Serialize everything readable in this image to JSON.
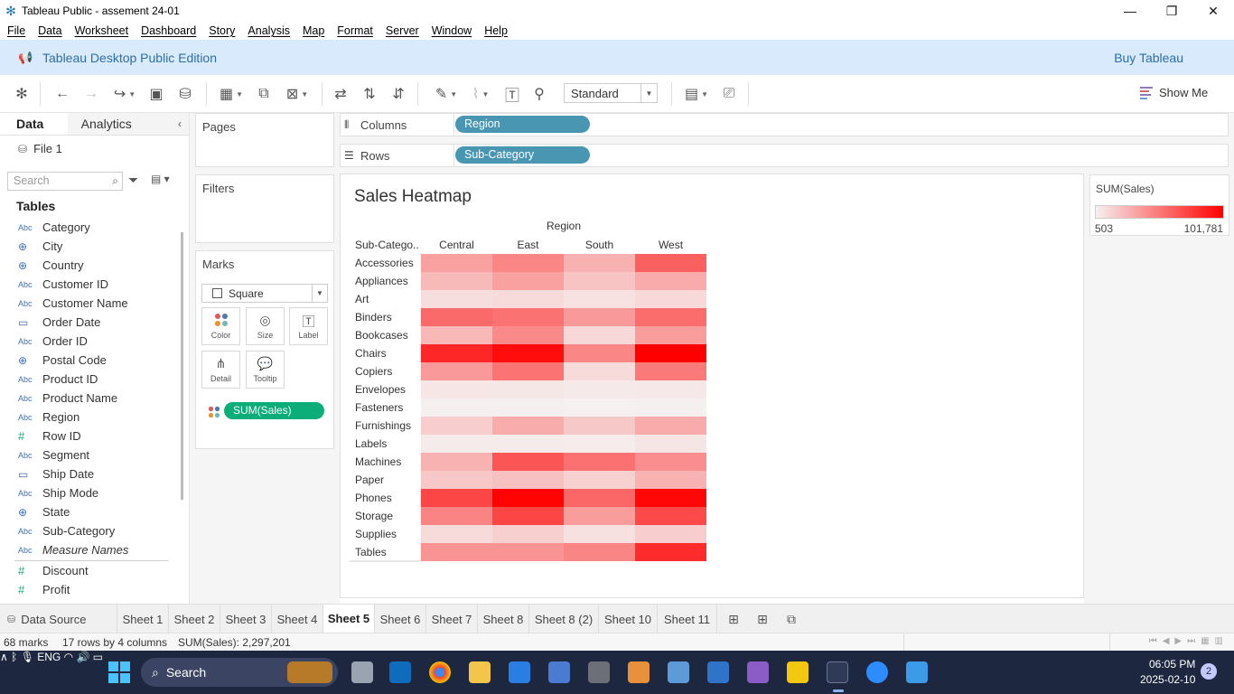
{
  "window": {
    "title": "Tableau Public - assement 24-01"
  },
  "menu": [
    "File",
    "Data",
    "Worksheet",
    "Dashboard",
    "Story",
    "Analysis",
    "Map",
    "Format",
    "Server",
    "Window",
    "Help"
  ],
  "banner": {
    "edition": "Tableau Desktop Public Edition",
    "buy": "Buy Tableau"
  },
  "toolbar": {
    "fit": "Standard",
    "show_me": "Show Me"
  },
  "data_pane": {
    "tabs": [
      "Data",
      "Analytics"
    ],
    "datasource": "File 1",
    "search_placeholder": "Search",
    "tables_label": "Tables",
    "dimensions": [
      {
        "type": "Abc",
        "name": "Category"
      },
      {
        "type": "globe",
        "name": "City"
      },
      {
        "type": "globe",
        "name": "Country"
      },
      {
        "type": "Abc",
        "name": "Customer ID"
      },
      {
        "type": "Abc",
        "name": "Customer Name"
      },
      {
        "type": "cal",
        "name": "Order Date"
      },
      {
        "type": "Abc",
        "name": "Order ID"
      },
      {
        "type": "globe",
        "name": "Postal Code"
      },
      {
        "type": "Abc",
        "name": "Product ID"
      },
      {
        "type": "Abc",
        "name": "Product Name"
      },
      {
        "type": "Abc",
        "name": "Region"
      },
      {
        "type": "#",
        "name": "Row ID"
      },
      {
        "type": "Abc",
        "name": "Segment"
      },
      {
        "type": "cal",
        "name": "Ship Date"
      },
      {
        "type": "Abc",
        "name": "Ship Mode"
      },
      {
        "type": "globe",
        "name": "State"
      },
      {
        "type": "Abc",
        "name": "Sub-Category"
      },
      {
        "type": "Abc",
        "name": "Measure Names",
        "italic": true
      }
    ],
    "measures": [
      {
        "type": "#",
        "name": "Discount"
      },
      {
        "type": "#",
        "name": "Profit"
      }
    ]
  },
  "cards": {
    "pages": "Pages",
    "filters": "Filters",
    "marks": "Marks",
    "mark_type": "Square",
    "mark_buttons": [
      "Color",
      "Size",
      "Label",
      "Detail",
      "Tooltip"
    ],
    "color_field": "SUM(Sales)"
  },
  "shelves": {
    "columns_label": "Columns",
    "columns_pill": "Region",
    "rows_label": "Rows",
    "rows_pill": "Sub-Category"
  },
  "view": {
    "title": "Sales Heatmap",
    "region_header": "Region",
    "subcat_header": "Sub-Catego.."
  },
  "chart_data": {
    "type": "heatmap",
    "title": "Sales Heatmap",
    "x_title": "Region",
    "y_title": "Sub-Catego..",
    "columns": [
      "Central",
      "East",
      "South",
      "West"
    ],
    "rows": [
      "Accessories",
      "Appliances",
      "Art",
      "Binders",
      "Bookcases",
      "Chairs",
      "Copiers",
      "Envelopes",
      "Fasteners",
      "Furnishings",
      "Labels",
      "Machines",
      "Paper",
      "Phones",
      "Storage",
      "Supplies",
      "Tables"
    ],
    "measure": "SUM(Sales)",
    "color_range": [
      503,
      101781
    ],
    "color_low": "#f6f0f0",
    "color_high": "#ff0000",
    "values": [
      [
        33957,
        45034,
        27276,
        61114
      ],
      [
        23582,
        34188,
        19525,
        30236
      ],
      [
        8019,
        9215,
        6698,
        10163
      ],
      [
        56924,
        53498,
        37030,
        55962
      ],
      [
        24157,
        43820,
        10899,
        36004
      ],
      [
        85231,
        96261,
        45176,
        101781
      ],
      [
        37260,
        53219,
        9300,
        50316
      ],
      [
        4637,
        4376,
        3346,
        3934
      ],
      [
        778,
        799,
        503,
        924
      ],
      [
        15255,
        29071,
        17307,
        29445
      ],
      [
        2452,
        2603,
        2353,
        5079
      ],
      [
        26797,
        66106,
        53891,
        42444
      ],
      [
        17492,
        20173,
        14151,
        26664
      ],
      [
        72687,
        100615,
        58304,
        98685
      ],
      [
        45931,
        72056,
        35768,
        70380
      ],
      [
        9468,
        14588,
        7342,
        15192
      ],
      [
        39154,
        39140,
        45823,
        83735
      ]
    ],
    "legend_min": "503",
    "legend_max": "101,781"
  },
  "sheet_tabs": [
    "Data Source",
    "Sheet 1",
    "Sheet 2",
    "Sheet 3",
    "Sheet 4",
    "Sheet 5",
    "Sheet 6",
    "Sheet 7",
    "Sheet 8",
    "Sheet 8 (2)",
    "Sheet 10",
    "Sheet 11"
  ],
  "active_sheet": "Sheet 5",
  "status": {
    "marks": "68 marks",
    "dims": "17 rows by 4 columns",
    "sum": "SUM(Sales): 2,297,201"
  },
  "taskbar": {
    "search": "Search",
    "lang": "ENG",
    "time": "06:05 PM",
    "date": "2025-02-10",
    "notifications": "2"
  }
}
